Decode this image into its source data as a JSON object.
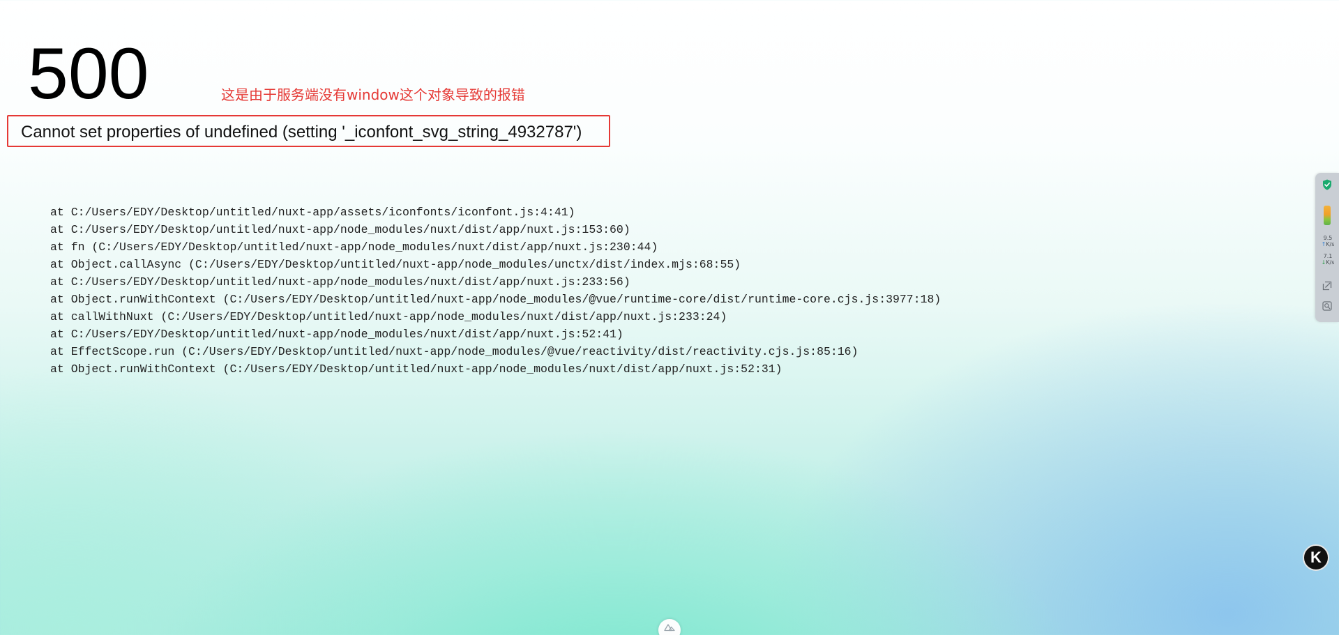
{
  "error": {
    "status_code": "500",
    "message": "Cannot set properties of undefined (setting '_iconfont_svg_string_4932787')",
    "annotation": "这是由于服务端没有window这个对象导致的报错",
    "stack": [
      "at C:/Users/EDY/Desktop/untitled/nuxt-app/assets/iconfonts/iconfont.js:4:41)",
      "at C:/Users/EDY/Desktop/untitled/nuxt-app/node_modules/nuxt/dist/app/nuxt.js:153:60)",
      "at fn (C:/Users/EDY/Desktop/untitled/nuxt-app/node_modules/nuxt/dist/app/nuxt.js:230:44)",
      "at Object.callAsync (C:/Users/EDY/Desktop/untitled/nuxt-app/node_modules/unctx/dist/index.mjs:68:55)",
      "at C:/Users/EDY/Desktop/untitled/nuxt-app/node_modules/nuxt/dist/app/nuxt.js:233:56)",
      "at Object.runWithContext (C:/Users/EDY/Desktop/untitled/nuxt-app/node_modules/@vue/runtime-core/dist/runtime-core.cjs.js:3977:18)",
      "at callWithNuxt (C:/Users/EDY/Desktop/untitled/nuxt-app/node_modules/nuxt/dist/app/nuxt.js:233:24)",
      "at C:/Users/EDY/Desktop/untitled/nuxt-app/node_modules/nuxt/dist/app/nuxt.js:52:41)",
      "at EffectScope.run (C:/Users/EDY/Desktop/untitled/nuxt-app/node_modules/@vue/reactivity/dist/reactivity.cjs.js:85:16)",
      "at Object.runWithContext (C:/Users/EDY/Desktop/untitled/nuxt-app/node_modules/nuxt/dist/app/nuxt.js:52:31)"
    ]
  },
  "side_panel": {
    "upload_value": "9.5",
    "upload_unit": "K/s",
    "download_value": "7.1",
    "download_unit": "K/s",
    "icons": [
      "shield-icon",
      "usage-bar-icon",
      "screenshot-icon",
      "search-icon"
    ]
  },
  "floating": {
    "k_badge_letter": "K",
    "devtools_icon": "nuxt-logo-icon"
  },
  "colors": {
    "annotation": "#e53935",
    "highlight_border": "#e53935",
    "shield": "#1aaa6e"
  }
}
